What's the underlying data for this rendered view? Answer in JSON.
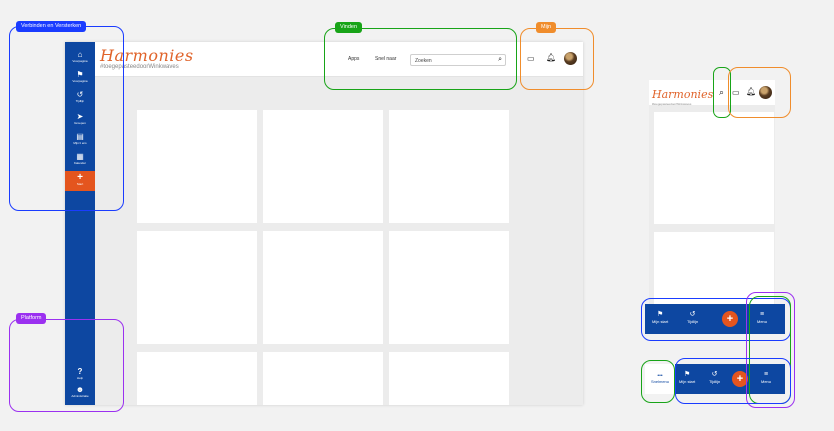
{
  "colors": {
    "primary": "#0d47a1",
    "accent": "#e4551e",
    "annotation_blue": "#1a3cff",
    "annotation_green": "#18a418",
    "annotation_orange": "#f08d2c",
    "annotation_purple": "#9b30f0"
  },
  "annotations": {
    "verbinden": "Verbinden en Versterken",
    "vinden": "Vinden",
    "mijn": "Mijn",
    "platform": "Platform"
  },
  "brand": {
    "logo_text": "Harmonies",
    "tagline": "#toegepasteedoorWinkwaves"
  },
  "header": {
    "apps": "Apps",
    "snel_naar": "Snel naar",
    "search_placeholder": "Zoeken",
    "monitor_icon": "monitor-icon",
    "bell_icon": "bell-icon",
    "search_icon": "search-icon"
  },
  "sidebar": {
    "items": [
      {
        "icon": "home-icon",
        "glyph": "⌂",
        "label": "Voorpagina"
      },
      {
        "icon": "flag-icon",
        "glyph": "⚑",
        "label": "Voorpagina"
      },
      {
        "icon": "history-icon",
        "glyph": "↺",
        "label": "Tijdlijn"
      },
      {
        "icon": "send-icon",
        "glyph": "➤",
        "label": "Groepen"
      },
      {
        "icon": "document-icon",
        "glyph": "▤",
        "label": "Mijn li ens"
      },
      {
        "icon": "calendar-icon",
        "glyph": "▦",
        "label": "Kalender"
      },
      {
        "icon": "plus-icon",
        "glyph": "+",
        "label": "Start"
      }
    ],
    "help": {
      "icon": "help-icon",
      "glyph": "?",
      "label": "Help"
    },
    "admin": {
      "icon": "admin-icon",
      "glyph": "☻",
      "label": "Administratie"
    }
  },
  "mobile_bar_1": {
    "items": [
      {
        "icon": "flag-icon",
        "glyph": "⚑",
        "label": "Mijn start"
      },
      {
        "icon": "history-icon",
        "glyph": "↺",
        "label": "Tijdlijn"
      },
      {
        "icon": "menu-icon",
        "glyph": "≡",
        "label": "Menu"
      }
    ],
    "fab": "+"
  },
  "mobile_bar_2": {
    "snelmenu": {
      "icon": "more-icon",
      "glyph": "•••",
      "label": "Snelmenu"
    },
    "items": [
      {
        "icon": "flag-icon",
        "glyph": "⚑",
        "label": "Mijn start"
      },
      {
        "icon": "history-icon",
        "glyph": "↺",
        "label": "Tijdlijn"
      },
      {
        "icon": "menu-icon",
        "glyph": "≡",
        "label": "Menu"
      }
    ],
    "fab": "+"
  }
}
